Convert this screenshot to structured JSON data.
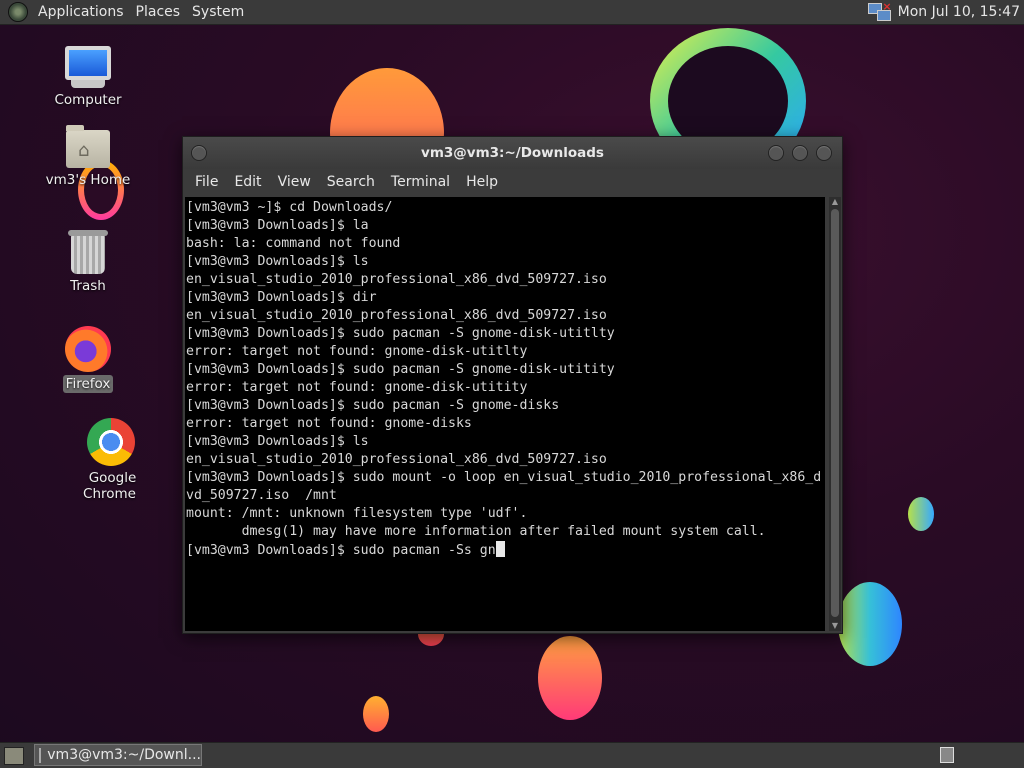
{
  "top_panel": {
    "menus": [
      "Applications",
      "Places",
      "System"
    ],
    "clock": "Mon Jul 10, 15:47",
    "network_icon": "network-disconnected-icon"
  },
  "desktop_icons": [
    {
      "label": "Computer",
      "icon": "computer-icon"
    },
    {
      "label": "vm3's Home",
      "icon": "home-folder-icon"
    },
    {
      "label": "Trash",
      "icon": "trash-icon"
    },
    {
      "label": "Firefox",
      "icon": "firefox-icon",
      "selected": true
    },
    {
      "label": "Google Chrome",
      "icon": "chrome-icon"
    }
  ],
  "terminal": {
    "title": "vm3@vm3:~/Downloads",
    "menu": [
      "File",
      "Edit",
      "View",
      "Search",
      "Terminal",
      "Help"
    ],
    "lines": [
      "[vm3@vm3 ~]$ cd Downloads/",
      "[vm3@vm3 Downloads]$ la",
      "bash: la: command not found",
      "[vm3@vm3 Downloads]$ ls",
      "en_visual_studio_2010_professional_x86_dvd_509727.iso",
      "[vm3@vm3 Downloads]$ dir",
      "en_visual_studio_2010_professional_x86_dvd_509727.iso",
      "[vm3@vm3 Downloads]$ sudo pacman -S gnome-disk-utitlty",
      "error: target not found: gnome-disk-utitlty",
      "[vm3@vm3 Downloads]$ sudo pacman -S gnome-disk-utitity",
      "error: target not found: gnome-disk-utitity",
      "[vm3@vm3 Downloads]$ sudo pacman -S gnome-disks",
      "error: target not found: gnome-disks",
      "[vm3@vm3 Downloads]$ ls",
      "en_visual_studio_2010_professional_x86_dvd_509727.iso",
      "[vm3@vm3 Downloads]$ sudo mount -o loop en_visual_studio_2010_professional_x86_d",
      "vd_509727.iso  /mnt",
      "mount: /mnt: unknown filesystem type 'udf'.",
      "       dmesg(1) may have more information after failed mount system call."
    ],
    "current_input": "[vm3@vm3 Downloads]$ sudo pacman -Ss gn"
  },
  "taskbar": {
    "window_button": "vm3@vm3:~/Downl..."
  }
}
